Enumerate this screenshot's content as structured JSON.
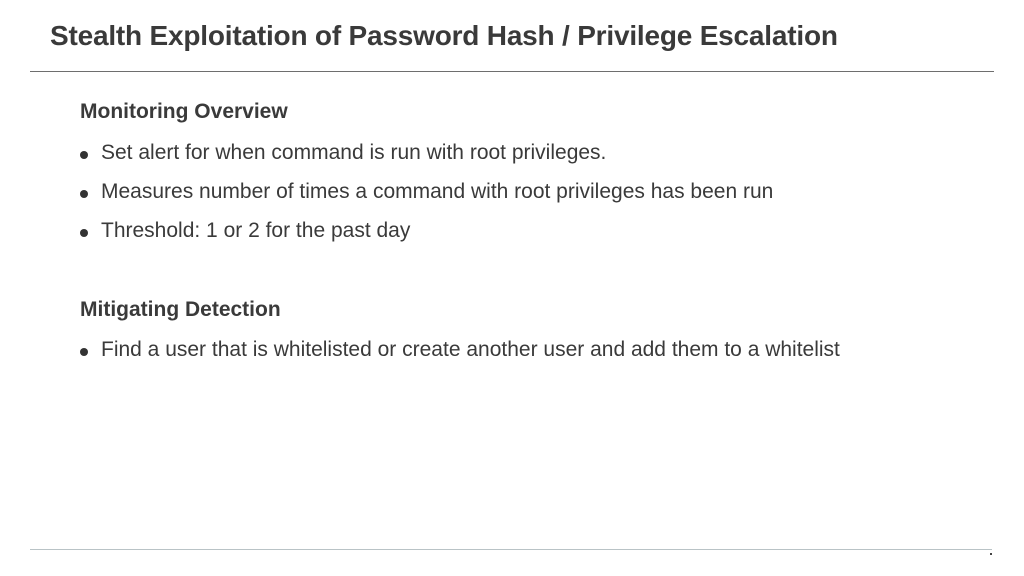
{
  "slide": {
    "title": "Stealth Exploitation of Password Hash / Privilege Escalation"
  },
  "monitoring": {
    "heading": "Monitoring Overview",
    "bullets": [
      "Set alert for when command is run with root privileges.",
      "Measures number of times a command with root privileges has been run",
      "Threshold: 1 or 2 for the past day"
    ]
  },
  "mitigating": {
    "heading": "Mitigating Detection",
    "bullets": [
      "Find a user that is whitelisted or create another user and add them to a whitelist"
    ]
  }
}
